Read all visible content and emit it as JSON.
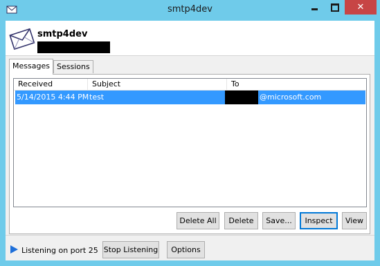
{
  "window": {
    "title": "smtp4dev",
    "controls": {
      "minimize": "minimize",
      "maximize": "maximize",
      "close": "✕"
    }
  },
  "header": {
    "app_name": "smtp4dev"
  },
  "tabs": [
    {
      "label": "Messages",
      "active": true
    },
    {
      "label": "Sessions",
      "active": false
    }
  ],
  "messages": {
    "columns": [
      "Received",
      "Subject",
      "To"
    ],
    "rows": [
      {
        "received": "5/14/2015 4:44 PM",
        "subject": "test",
        "to_suffix": "@microsoft.com"
      }
    ]
  },
  "actions": {
    "delete_all": "Delete All",
    "delete": "Delete",
    "save": "Save...",
    "inspect": "Inspect",
    "view": "View"
  },
  "status": {
    "text": "Listening on port 25",
    "stop_listening": "Stop Listening",
    "options": "Options"
  },
  "colors": {
    "titlebar": "#6fcbea",
    "selection": "#3399ff",
    "close_button": "#c74545",
    "status_icon": "#1e6fd9"
  }
}
